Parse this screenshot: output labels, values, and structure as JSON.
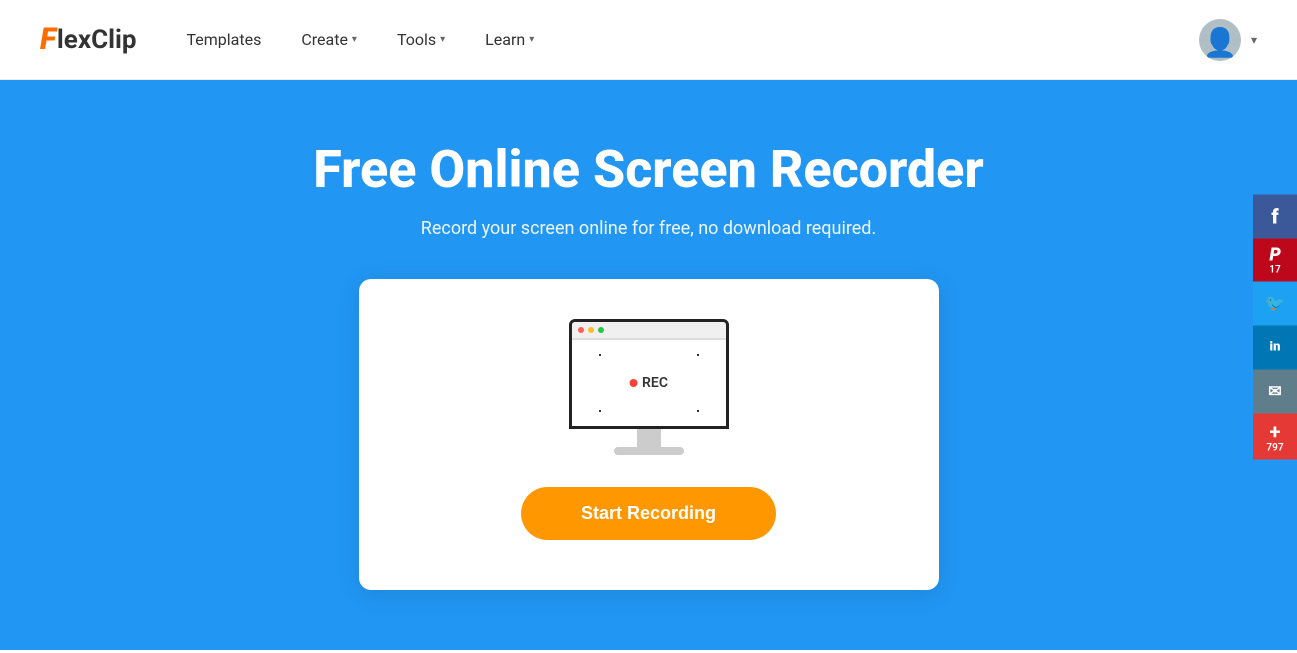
{
  "nav": {
    "logo_text": "FlexClip",
    "logo_f": "F",
    "logo_rest": "lexClip",
    "links": [
      {
        "id": "templates",
        "label": "Templates",
        "has_dropdown": false
      },
      {
        "id": "create",
        "label": "Create",
        "has_dropdown": true
      },
      {
        "id": "tools",
        "label": "Tools",
        "has_dropdown": true
      },
      {
        "id": "learn",
        "label": "Learn",
        "has_dropdown": true
      }
    ],
    "user_chevron": "▾"
  },
  "hero": {
    "title": "Free Online Screen Recorder",
    "subtitle": "Record your screen online for free, no download required.",
    "rec_label": "REC",
    "start_button": "Start Recording"
  },
  "social": [
    {
      "id": "facebook",
      "icon": "f",
      "type": "facebook",
      "count": null
    },
    {
      "id": "pinterest",
      "icon": "P",
      "type": "pinterest",
      "count": "17"
    },
    {
      "id": "twitter",
      "icon": "t",
      "type": "twitter",
      "count": null
    },
    {
      "id": "linkedin",
      "icon": "in",
      "type": "linkedin",
      "count": null
    },
    {
      "id": "email",
      "icon": "✉",
      "type": "email",
      "count": null
    },
    {
      "id": "plus",
      "icon": "+",
      "type": "plus",
      "count": "797"
    }
  ],
  "colors": {
    "accent_blue": "#2196f3",
    "accent_orange": "#ff9800",
    "facebook": "#3b5998",
    "pinterest": "#bd081c",
    "twitter": "#1da1f2",
    "linkedin": "#0077b5",
    "email": "#607d8b",
    "plus_red": "#e53935"
  }
}
